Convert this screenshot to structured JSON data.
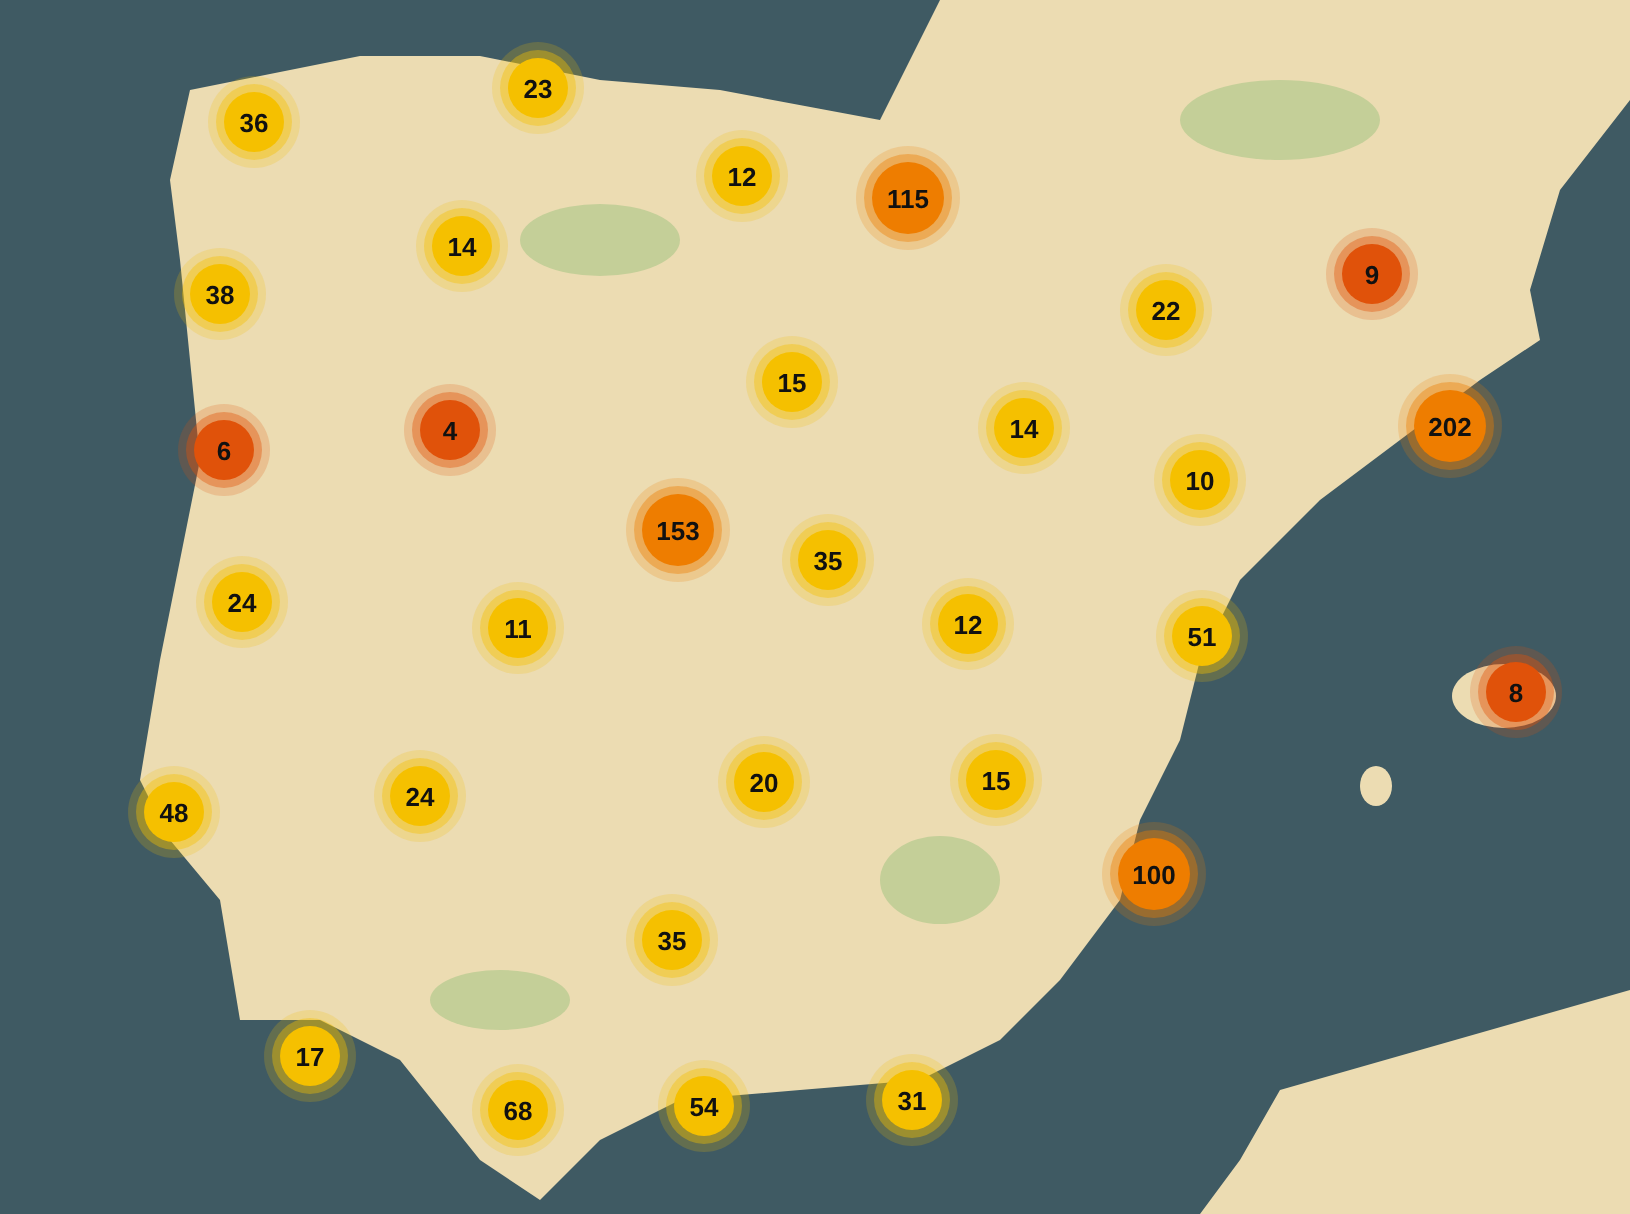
{
  "clusters": [
    {
      "count": "36",
      "color": "#f5c000"
    },
    {
      "count": "23",
      "color": "#f5c000"
    },
    {
      "count": "12",
      "color": "#f5c000"
    },
    {
      "count": "115",
      "color": "#ee7d00"
    },
    {
      "count": "14",
      "color": "#f5c000"
    },
    {
      "count": "38",
      "color": "#f5c000"
    },
    {
      "count": "22",
      "color": "#f5c000"
    },
    {
      "count": "9",
      "color": "#e0520a"
    },
    {
      "count": "15",
      "color": "#f5c000"
    },
    {
      "count": "4",
      "color": "#e0520a"
    },
    {
      "count": "6",
      "color": "#e0520a"
    },
    {
      "count": "14",
      "color": "#f5c000"
    },
    {
      "count": "202",
      "color": "#ee7d00"
    },
    {
      "count": "10",
      "color": "#f5c000"
    },
    {
      "count": "153",
      "color": "#ee7d00"
    },
    {
      "count": "35",
      "color": "#f5c000"
    },
    {
      "count": "24",
      "color": "#f5c000"
    },
    {
      "count": "11",
      "color": "#f5c000"
    },
    {
      "count": "12",
      "color": "#f5c000"
    },
    {
      "count": "51",
      "color": "#f5c000"
    },
    {
      "count": "8",
      "color": "#e0520a"
    },
    {
      "count": "48",
      "color": "#f5c000"
    },
    {
      "count": "24",
      "color": "#f5c000"
    },
    {
      "count": "20",
      "color": "#f5c000"
    },
    {
      "count": "15",
      "color": "#f5c000"
    },
    {
      "count": "100",
      "color": "#ee7d00"
    },
    {
      "count": "35",
      "color": "#f5c000"
    },
    {
      "count": "17",
      "color": "#f5c000"
    },
    {
      "count": "68",
      "color": "#f5c000"
    },
    {
      "count": "54",
      "color": "#f5c000"
    },
    {
      "count": "31",
      "color": "#f5c000"
    }
  ]
}
